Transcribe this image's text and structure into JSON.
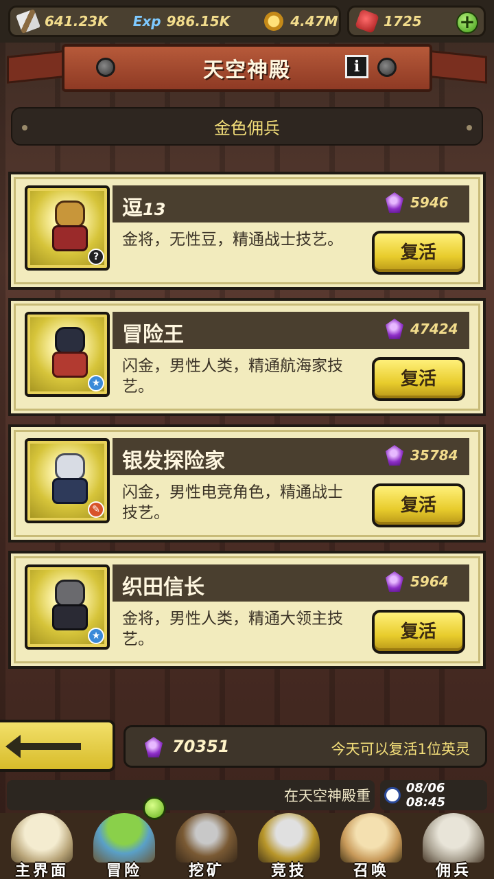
{
  "resources": {
    "power": "641.23K",
    "exp_label": "Exp",
    "exp": "986.15K",
    "gold": "4.47M",
    "rubies": "1725",
    "add_symbol": "+"
  },
  "header": {
    "title": "天空神殿",
    "info_symbol": "i"
  },
  "section": {
    "title": "金色佣兵"
  },
  "heroes": [
    {
      "name": "逗",
      "name_num": "13",
      "cost": "5946",
      "desc": "金将，无性豆，精通战士技艺。",
      "button": "复活",
      "badge": "?"
    },
    {
      "name": "冒险王",
      "name_num": "",
      "cost": "47424",
      "desc": "闪金，男性人类，精通航海家技艺。",
      "button": "复活",
      "badge": "★"
    },
    {
      "name": "银发探险家",
      "name_num": "",
      "cost": "35784",
      "desc": "闪金，男性电竞角色，精通战士技艺。",
      "button": "复活",
      "badge": "✎"
    },
    {
      "name": "织田信长",
      "name_num": "",
      "cost": "5964",
      "desc": "金将，男性人类，精通大领主技艺。",
      "button": "复活",
      "badge": "★"
    }
  ],
  "footer": {
    "gem_total": "70351",
    "note": "今天可以复活1位英灵",
    "ticker": "在天空神殿重",
    "time": "08/06 08:45"
  },
  "nav": [
    {
      "label": "主界面"
    },
    {
      "label": "冒险"
    },
    {
      "label": "挖矿"
    },
    {
      "label": "竞技"
    },
    {
      "label": "召唤"
    },
    {
      "label": "佣兵"
    }
  ],
  "colors": {
    "accent_gold": "#f2dc8c",
    "card_bg": "#f2ebbd",
    "button_yellow": "#e8cc2c",
    "gem_purple": "#8e2fc8"
  }
}
